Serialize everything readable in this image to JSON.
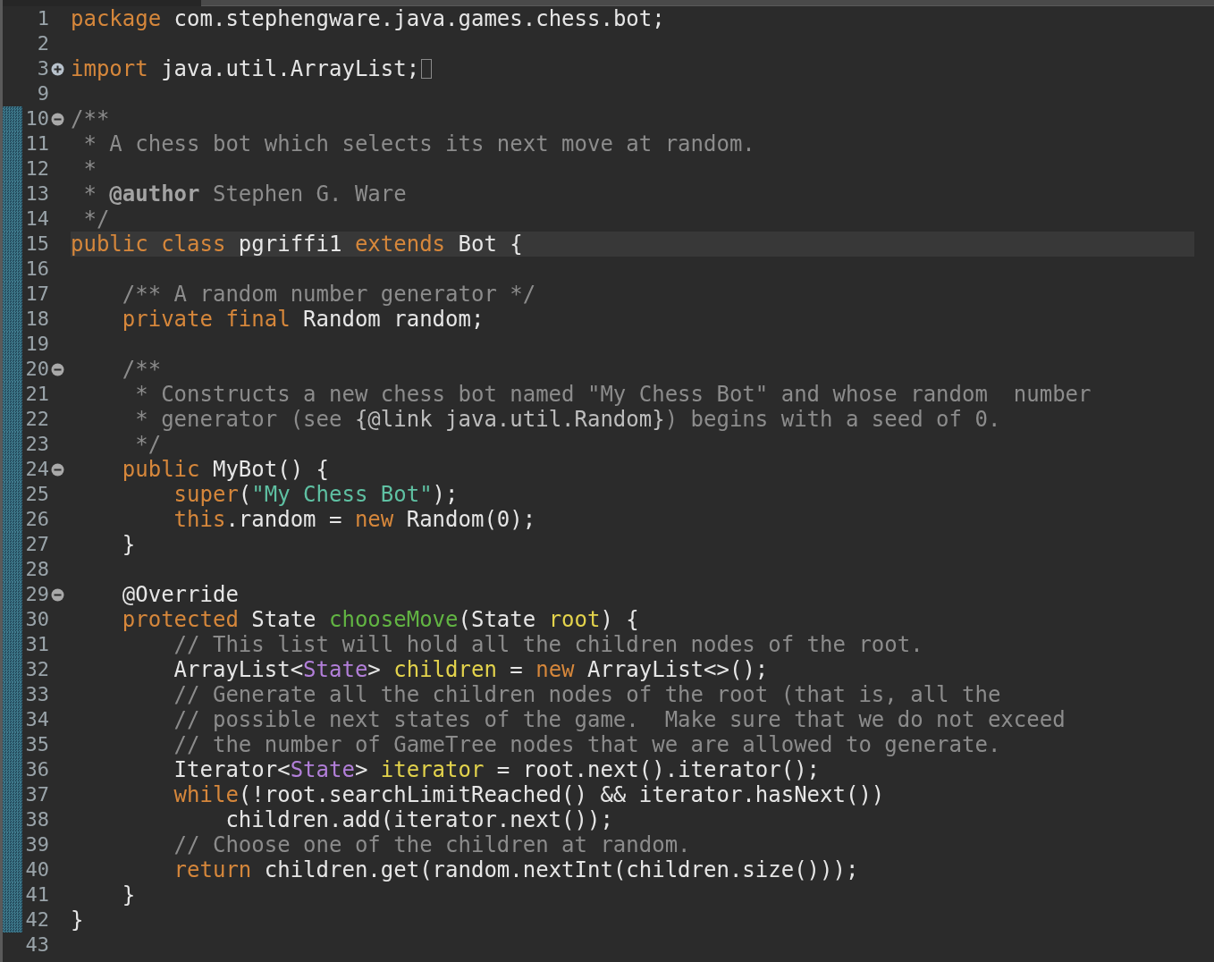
{
  "editor": {
    "lines": [
      {
        "number": "1",
        "changed": false,
        "current": false,
        "tokens": [
          {
            "kind": "keyword",
            "text": "package"
          },
          {
            "kind": "plain",
            "text": " com.stephengware.java.games.chess.bot;"
          }
        ]
      },
      {
        "number": "2",
        "changed": false,
        "current": false
      },
      {
        "number": "3",
        "fold_toggle": {
          "collapsed": true
        },
        "changed": false,
        "current": false,
        "tokens": [
          {
            "kind": "keyword",
            "text": "import"
          },
          {
            "kind": "plain",
            "text": " java.util.ArrayList;"
          }
        ]
      },
      {
        "number": "9",
        "changed": false,
        "current": false
      },
      {
        "number": "10",
        "fold_toggle": {
          "collapsed": false
        },
        "changed": true,
        "current": false,
        "tokens": [
          {
            "kind": "comment",
            "text": "/**"
          }
        ]
      },
      {
        "number": "11",
        "changed": true,
        "current": false,
        "tokens": [
          {
            "kind": "comment",
            "text": " * A chess bot which selects its next move at random."
          }
        ]
      },
      {
        "number": "12",
        "changed": true,
        "current": false,
        "tokens": [
          {
            "kind": "comment",
            "text": " *"
          }
        ]
      },
      {
        "number": "13",
        "changed": true,
        "current": false,
        "tokens": [
          {
            "kind": "comment",
            "text": " *"
          },
          {
            "kind": "doctag",
            "text": " @author"
          },
          {
            "kind": "comment",
            "text": " Stephen G. Ware"
          }
        ]
      },
      {
        "number": "14",
        "changed": true,
        "current": false,
        "tokens": [
          {
            "kind": "comment",
            "text": " */"
          }
        ]
      },
      {
        "number": "15",
        "changed": true,
        "current": true,
        "tokens": [
          {
            "kind": "keyword",
            "text": "public"
          },
          {
            "kind": "keyword",
            "text": " class"
          },
          {
            "kind": "plain",
            "text": " pgriffi1"
          },
          {
            "kind": "keyword",
            "text": " extends"
          },
          {
            "kind": "plain",
            "text": " Bot {"
          }
        ]
      },
      {
        "number": "16",
        "changed": true,
        "current": false
      },
      {
        "number": "17",
        "changed": true,
        "current": false,
        "tokens": [
          {
            "kind": "comment",
            "text": "    /** A random number generator */"
          }
        ]
      },
      {
        "number": "18",
        "changed": true,
        "current": false,
        "tokens": [
          {
            "kind": "keyword",
            "text": "    private"
          },
          {
            "kind": "keyword",
            "text": " final"
          },
          {
            "kind": "plain",
            "text": " Random random;"
          }
        ]
      },
      {
        "number": "19",
        "changed": true,
        "current": false
      },
      {
        "number": "20",
        "fold_toggle": {
          "collapsed": false
        },
        "changed": true,
        "current": false,
        "tokens": [
          {
            "kind": "comment",
            "text": "    /**"
          }
        ]
      },
      {
        "number": "21",
        "changed": true,
        "current": false,
        "tokens": [
          {
            "kind": "comment",
            "text": "     * Constructs a new chess bot named \"My Chess Bot\" and whose random  number"
          }
        ]
      },
      {
        "number": "22",
        "changed": true,
        "current": false,
        "tokens": [
          {
            "kind": "comment",
            "text": "     * generator (see"
          },
          {
            "kind": "doclink",
            "text": " {@link java.util.Random}"
          },
          {
            "kind": "comment",
            "text": ") begins with a seed of 0."
          }
        ]
      },
      {
        "number": "23",
        "changed": true,
        "current": false,
        "tokens": [
          {
            "kind": "comment",
            "text": "     */"
          }
        ]
      },
      {
        "number": "24",
        "fold_toggle": {
          "collapsed": false
        },
        "changed": true,
        "current": false,
        "tokens": [
          {
            "kind": "keyword",
            "text": "    public"
          },
          {
            "kind": "plain",
            "text": " MyBot() {"
          }
        ]
      },
      {
        "number": "25",
        "changed": true,
        "current": false,
        "tokens": [
          {
            "kind": "keyword",
            "text": "        super"
          },
          {
            "kind": "plain",
            "text": "("
          },
          {
            "kind": "string",
            "text": "\"My Chess Bot\""
          },
          {
            "kind": "plain",
            "text": ");"
          }
        ]
      },
      {
        "number": "26",
        "changed": true,
        "current": false,
        "tokens": [
          {
            "kind": "keyword",
            "text": "        this"
          },
          {
            "kind": "plain",
            "text": ".random ="
          },
          {
            "kind": "keyword",
            "text": " new"
          },
          {
            "kind": "plain",
            "text": " Random(0);"
          }
        ]
      },
      {
        "number": "27",
        "changed": true,
        "current": false,
        "tokens": [
          {
            "kind": "plain",
            "text": "    }"
          }
        ]
      },
      {
        "number": "28",
        "changed": true,
        "current": false
      },
      {
        "number": "29",
        "fold_toggle": {
          "collapsed": false
        },
        "changed": true,
        "current": false,
        "tokens": [
          {
            "kind": "annotation",
            "text": "    @Override"
          }
        ]
      },
      {
        "number": "30",
        "changed": true,
        "current": false,
        "tokens": [
          {
            "kind": "keyword",
            "text": "    protected"
          },
          {
            "kind": "plain",
            "text": " State"
          },
          {
            "kind": "method",
            "text": " chooseMove"
          },
          {
            "kind": "plain",
            "text": "(State"
          },
          {
            "kind": "variable",
            "text": " root"
          },
          {
            "kind": "plain",
            "text": ") {"
          }
        ]
      },
      {
        "number": "31",
        "changed": true,
        "current": false,
        "tokens": [
          {
            "kind": "comment",
            "text": "        // This list will hold all the children nodes of the root."
          }
        ]
      },
      {
        "number": "32",
        "changed": true,
        "current": false,
        "tokens": [
          {
            "kind": "plain",
            "text": "        ArrayList<"
          },
          {
            "kind": "typeparam",
            "text": "State"
          },
          {
            "kind": "plain",
            "text": ">"
          },
          {
            "kind": "variable",
            "text": " children"
          },
          {
            "kind": "plain",
            "text": " ="
          },
          {
            "kind": "keyword",
            "text": " new"
          },
          {
            "kind": "plain",
            "text": " ArrayList<>();"
          }
        ]
      },
      {
        "number": "33",
        "changed": true,
        "current": false,
        "tokens": [
          {
            "kind": "comment",
            "text": "        // Generate all the children nodes of the root (that is, all the"
          }
        ]
      },
      {
        "number": "34",
        "changed": true,
        "current": false,
        "tokens": [
          {
            "kind": "comment",
            "text": "        // possible next states of the game.  Make sure that we do not exceed"
          }
        ]
      },
      {
        "number": "35",
        "changed": true,
        "current": false,
        "tokens": [
          {
            "kind": "comment",
            "text": "        // the number of GameTree nodes that we are allowed to generate."
          }
        ]
      },
      {
        "number": "36",
        "changed": true,
        "current": false,
        "tokens": [
          {
            "kind": "plain",
            "text": "        Iterator<"
          },
          {
            "kind": "typeparam",
            "text": "State"
          },
          {
            "kind": "plain",
            "text": ">"
          },
          {
            "kind": "variable",
            "text": " iterator"
          },
          {
            "kind": "plain",
            "text": " = root.next().iterator();"
          }
        ]
      },
      {
        "number": "37",
        "changed": true,
        "current": false,
        "tokens": [
          {
            "kind": "keyword",
            "text": "        while"
          },
          {
            "kind": "plain",
            "text": "(!root.searchLimitReached() && iterator.hasNext())"
          }
        ]
      },
      {
        "number": "38",
        "changed": true,
        "current": false,
        "tokens": [
          {
            "kind": "plain",
            "text": "            children.add(iterator.next());"
          }
        ]
      },
      {
        "number": "39",
        "changed": true,
        "current": false,
        "tokens": [
          {
            "kind": "comment",
            "text": "        // Choose one of the children at random."
          }
        ]
      },
      {
        "number": "40",
        "changed": true,
        "current": false,
        "tokens": [
          {
            "kind": "keyword",
            "text": "        return"
          },
          {
            "kind": "plain",
            "text": " children.get(random.nextInt(children.size()));"
          }
        ]
      },
      {
        "number": "41",
        "changed": true,
        "current": false,
        "tokens": [
          {
            "kind": "plain",
            "text": "    }"
          }
        ]
      },
      {
        "number": "42",
        "changed": true,
        "current": false,
        "tokens": [
          {
            "kind": "plain",
            "text": "}"
          }
        ]
      },
      {
        "number": "43",
        "changed": false,
        "current": false
      }
    ]
  }
}
